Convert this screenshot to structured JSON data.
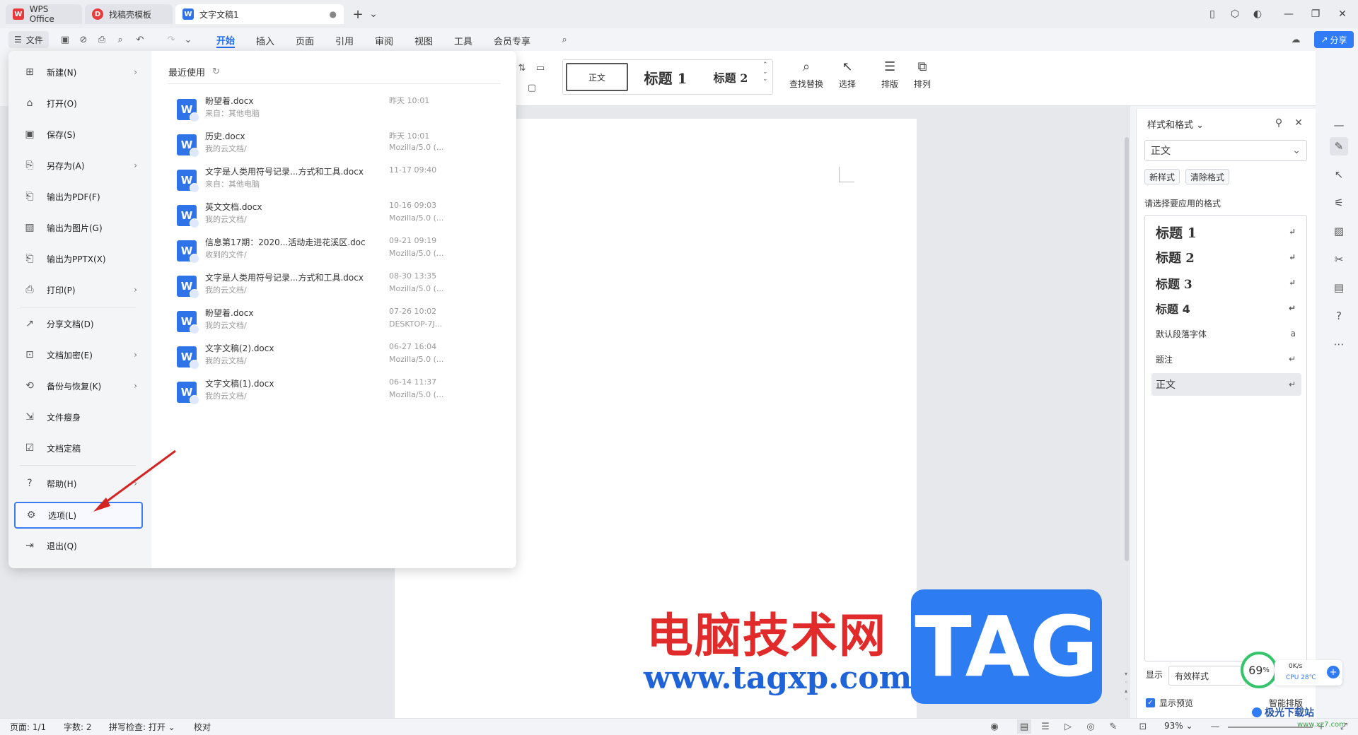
{
  "titlebar": {
    "tabs": [
      {
        "label": "WPS Office",
        "logo": "W",
        "color": "#e83a3a"
      },
      {
        "label": "找稿壳模板",
        "logo": "D",
        "color": "#e83a3a"
      },
      {
        "label": "文字文稿1",
        "logo": "W",
        "color": "#2f73e8",
        "close": "●"
      }
    ],
    "new_tab": "+",
    "tab_menu": "⌄"
  },
  "menubar": {
    "file_label": "文件",
    "items": [
      "开始",
      "插入",
      "页面",
      "引用",
      "审阅",
      "视图",
      "工具",
      "会员专享"
    ],
    "active": "开始",
    "share_label": "分享"
  },
  "ribbon": {
    "gallery": [
      "正文",
      "标题 1",
      "标题 2"
    ],
    "tools": [
      {
        "label": "查找替换",
        "icon": "search-icon"
      },
      {
        "label": "选择",
        "icon": "select-icon"
      },
      {
        "label": "排版",
        "icon": "layout-icon"
      },
      {
        "label": "排列",
        "icon": "arrange-icon"
      }
    ]
  },
  "file_menu": {
    "items": [
      {
        "label": "新建(N)",
        "icon": "new-icon",
        "arrow": true
      },
      {
        "label": "打开(O)",
        "icon": "folder-icon",
        "arrow": false
      },
      {
        "label": "保存(S)",
        "icon": "save-icon",
        "arrow": false
      },
      {
        "label": "另存为(A)",
        "icon": "save-as-icon",
        "arrow": true
      },
      {
        "label": "输出为PDF(F)",
        "icon": "pdf-icon",
        "arrow": false
      },
      {
        "label": "输出为图片(G)",
        "icon": "image-icon",
        "arrow": false
      },
      {
        "label": "输出为PPTX(X)",
        "icon": "pptx-icon",
        "arrow": false
      },
      {
        "label": "打印(P)",
        "icon": "print-icon",
        "arrow": true
      },
      {
        "label": "分享文档(D)",
        "icon": "share-icon",
        "arrow": false
      },
      {
        "label": "文档加密(E)",
        "icon": "lock-icon",
        "arrow": true
      },
      {
        "label": "备份与恢复(K)",
        "icon": "backup-icon",
        "arrow": true
      },
      {
        "label": "文件瘦身",
        "icon": "slim-icon",
        "arrow": false
      },
      {
        "label": "文档定稿",
        "icon": "finalize-icon",
        "arrow": false
      },
      {
        "label": "帮助(H)",
        "icon": "help-icon",
        "arrow": true
      },
      {
        "label": "选项(L)",
        "icon": "gear-icon",
        "arrow": false
      },
      {
        "label": "退出(Q)",
        "icon": "exit-icon",
        "arrow": false
      }
    ],
    "recent_title": "最近使用",
    "recent": [
      {
        "name": "盼望着.docx",
        "location": "来自：其他电脑",
        "time": "昨天  10:01",
        "source": ""
      },
      {
        "name": "历史.docx",
        "location": "我的云文档/",
        "time": "昨天  10:01",
        "source": "Mozilla/5.0 (..."
      },
      {
        "name": "文字是人类用符号记录...方式和工具.docx",
        "location": "来自：其他电脑",
        "time": "11-17 09:40",
        "source": ""
      },
      {
        "name": "英文文档.docx",
        "location": "我的云文档/",
        "time": "10-16 09:03",
        "source": "Mozilla/5.0 (..."
      },
      {
        "name": "信息第17期：2020...活动走进花溪区.doc",
        "location": "收到的文件/",
        "time": "09-21 09:19",
        "source": "Mozilla/5.0 (..."
      },
      {
        "name": "文字是人类用符号记录...方式和工具.docx",
        "location": "我的云文档/",
        "time": "08-30 13:35",
        "source": "Mozilla/5.0 (..."
      },
      {
        "name": "盼望着.docx",
        "location": "我的云文档/",
        "time": "07-26 10:02",
        "source": "DESKTOP-7J..."
      },
      {
        "name": "文字文稿(2).docx",
        "location": "我的云文档/",
        "time": "06-27 16:04",
        "source": "Mozilla/5.0 (..."
      },
      {
        "name": "文字文稿(1).docx",
        "location": "我的云文档/",
        "time": "06-14 11:37",
        "source": "Mozilla/5.0 (..."
      }
    ]
  },
  "style_panel": {
    "title": "样式和格式",
    "current_style": "正文",
    "new_style": "新样式",
    "clear_format": "清除格式",
    "apply_label": "请选择要应用的格式",
    "styles": [
      {
        "label": "标题  1",
        "mark": "↵"
      },
      {
        "label": "标题  2",
        "mark": "↵"
      },
      {
        "label": "标题  3",
        "mark": "↵"
      },
      {
        "label": "标题  4",
        "mark": "↵"
      },
      {
        "label": "默认段落字体",
        "mark": "a"
      },
      {
        "label": "题注",
        "mark": "↵"
      },
      {
        "label": "正文",
        "mark": "↵"
      }
    ],
    "show_label": "显示",
    "show_value": "有效样式",
    "preview_label": "显示预览",
    "smart_layout": "智能排版"
  },
  "statusbar": {
    "page": "页面: 1/1",
    "words": "字数: 2",
    "spell": "拼写检查: 打开",
    "proof": "校对",
    "zoom": "93%"
  },
  "watermark": {
    "cn": "电脑技术网",
    "url": "www.tagxp.com",
    "tag": "TAG",
    "site": "极光下载站",
    "site_url": "www.xz7.com"
  },
  "cpu_widget": {
    "percent": "69",
    "percent_sign": "%",
    "speed": "0K/s",
    "cpu": "CPU 28℃"
  },
  "colors": {
    "accent": "#1f6ff2",
    "highlight_border": "#3b7cf0",
    "arrow": "#d42424"
  }
}
